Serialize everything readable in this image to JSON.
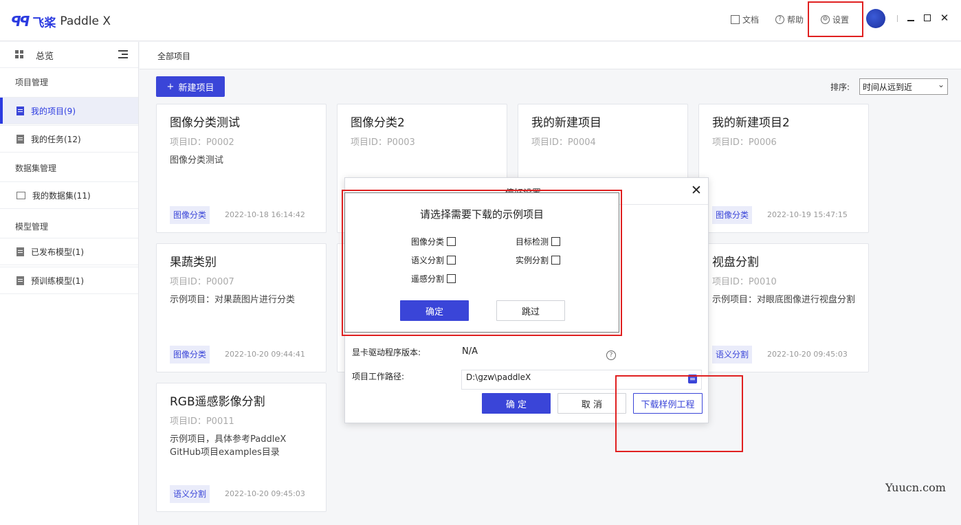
{
  "app": {
    "logo_mark": "飞",
    "logo_cn": "飞桨",
    "logo_en": "Paddle X"
  },
  "titlebar": {
    "docs_label": "文档",
    "help_label": "帮助",
    "settings_label": "设置",
    "minimize": "—",
    "maximize": "☐",
    "close": "✕"
  },
  "sidebar": {
    "overview_label": "总览",
    "groups": [
      {
        "label": "项目管理",
        "items": [
          {
            "label": "我的项目(9)",
            "active": true
          },
          {
            "label": "我的任务(12)"
          }
        ]
      },
      {
        "label": "数据集管理",
        "items": [
          {
            "label": "我的数据集(11)"
          }
        ]
      },
      {
        "label": "模型管理",
        "items": [
          {
            "label": "已发布模型(1)"
          },
          {
            "label": "预训练模型(1)"
          }
        ]
      }
    ]
  },
  "main": {
    "breadcrumb": "全部项目",
    "new_project_label": "新建项目",
    "sort_label": "排序:",
    "sort_value": "时间从远到近",
    "cards": [
      {
        "title": "图像分类测试",
        "pid": "项目ID：P0002",
        "desc": "图像分类测试",
        "tag": "图像分类",
        "time": "2022-10-18 16:14:42"
      },
      {
        "title": "图像分类2",
        "pid": "项目ID：P0003",
        "desc": "",
        "tag": "",
        "time": ""
      },
      {
        "title": "我的新建项目",
        "pid": "项目ID：P0004",
        "desc": "",
        "tag": "",
        "time": ""
      },
      {
        "title": "我的新建项目2",
        "pid": "项目ID：P0006",
        "desc": "",
        "tag": "图像分类",
        "time": "2022-10-19 15:47:15"
      },
      {
        "title": "果蔬类别",
        "pid": "项目ID：P0007",
        "desc": "示例项目：对果蔬图片进行分类",
        "tag": "图像分类",
        "time": "2022-10-20 09:44:41"
      },
      {
        "title": "视盘分割",
        "pid": "项目ID：P0010",
        "desc": "示例项目：对眼底图像进行视盘分割",
        "tag": "语义分割",
        "time": "2022-10-20 09:45:03"
      },
      {
        "title": "RGB遥感影像分割",
        "pid": "项目ID：P0011",
        "desc": "示例项目，具体参考PaddleX GitHub项目examples目录",
        "tag": "语义分割",
        "time": "2022-10-20 09:45:03"
      }
    ]
  },
  "pref_dialog": {
    "title": "偏好设置",
    "gpu_driver_label": "显卡驱动程序版本:",
    "gpu_driver_value": "N/A",
    "workpath_label": "项目工作路径:",
    "workpath_value": "D:\\gzw\\paddleX",
    "ok_label": "确 定",
    "cancel_label": "取 消",
    "download_label": "下载样例工程"
  },
  "sample_dialog": {
    "title": "请选择需要下载的示例项目",
    "options": [
      "图像分类",
      "目标检测",
      "语义分割",
      "实例分割",
      "遥感分割"
    ],
    "ok_label": "确定",
    "skip_label": "跳过"
  },
  "watermark": "Yuucn.com",
  "colors": {
    "accent": "#3a45d8",
    "annotation": "#e02020"
  }
}
